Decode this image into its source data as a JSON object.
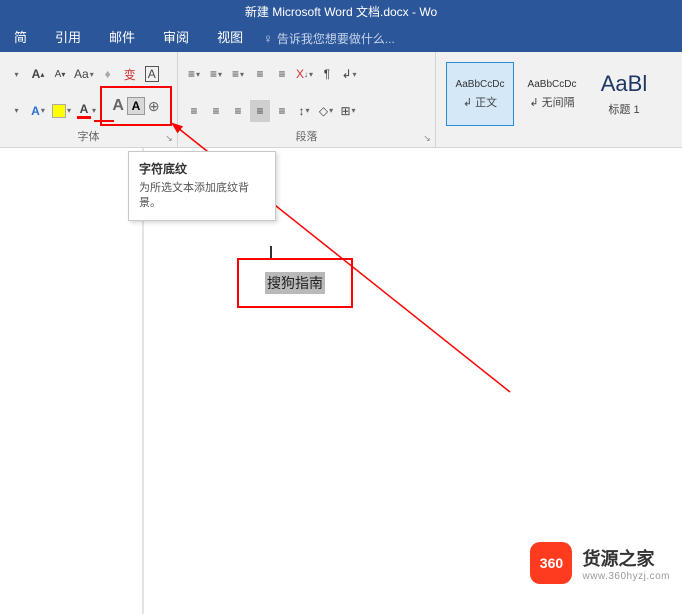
{
  "title": "新建 Microsoft Word 文档.docx - Wo",
  "tabs": {
    "simplified": "简",
    "references": "引用",
    "mailings": "邮件",
    "review": "审阅",
    "view": "视图"
  },
  "tellme": {
    "icon": "♀",
    "placeholder": "告诉我您想要做什么..."
  },
  "font": {
    "group_label": "字体",
    "grow": "A",
    "shrink": "A",
    "changecase": "Aa",
    "clear": "A",
    "phonetic": "A",
    "charborder": "A",
    "bold_alt": "A",
    "texteffect": "A",
    "highlight": "ab",
    "fontcolor": "A",
    "shading": "A",
    "enclose": "⊕"
  },
  "paragraph": {
    "group_label": "段落",
    "bullets": "≡",
    "numbering": "≡",
    "multilevel": "≡",
    "decrease": "≡",
    "increase": "≡",
    "sort": "A↓",
    "showmarks": "¶",
    "left": "≡",
    "center": "≡",
    "right": "≡",
    "justify": "≡",
    "distrib": "≡",
    "spacing": "↕",
    "shading2": "◇",
    "borders": "⊞"
  },
  "styles": {
    "normal": {
      "preview": "AaBbCcDc",
      "label": "↲ 正文"
    },
    "nospacing": {
      "preview": "AaBbCcDc",
      "label": "↲ 无间隔"
    },
    "heading1": {
      "preview": "AaBl",
      "label": "标题 1"
    }
  },
  "tooltip": {
    "title": "字符底纹",
    "body": "为所选文本添加底纹背景。"
  },
  "document": {
    "selected_text": "搜狗指南"
  },
  "watermark": {
    "badge": "360",
    "title": "货源之家",
    "url": "www.360hyzj.com"
  }
}
